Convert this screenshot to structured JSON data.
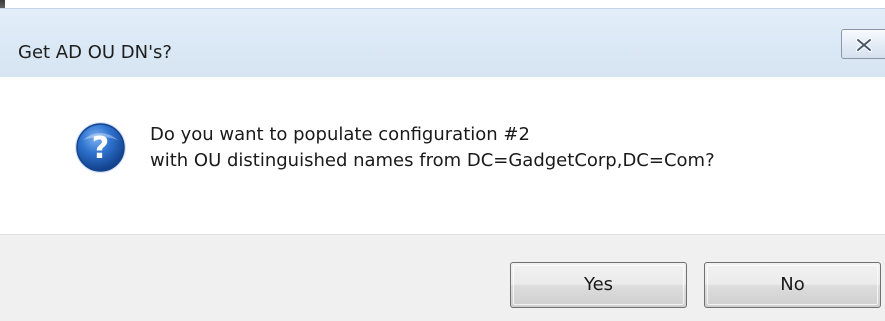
{
  "window": {
    "title": "Get AD OU DN's?",
    "close_icon": "close-icon"
  },
  "message": {
    "icon": "question-icon",
    "line1": "Do you want to populate configuration #2",
    "line2": "with OU distinguished names from DC=GadgetCorp,DC=Com?"
  },
  "buttons": {
    "yes_label": "Yes",
    "no_label": "No"
  },
  "colors": {
    "titlebar": "#dbe8f5",
    "footer": "#f0f0f0",
    "icon_blue": "#1f5fb4"
  }
}
